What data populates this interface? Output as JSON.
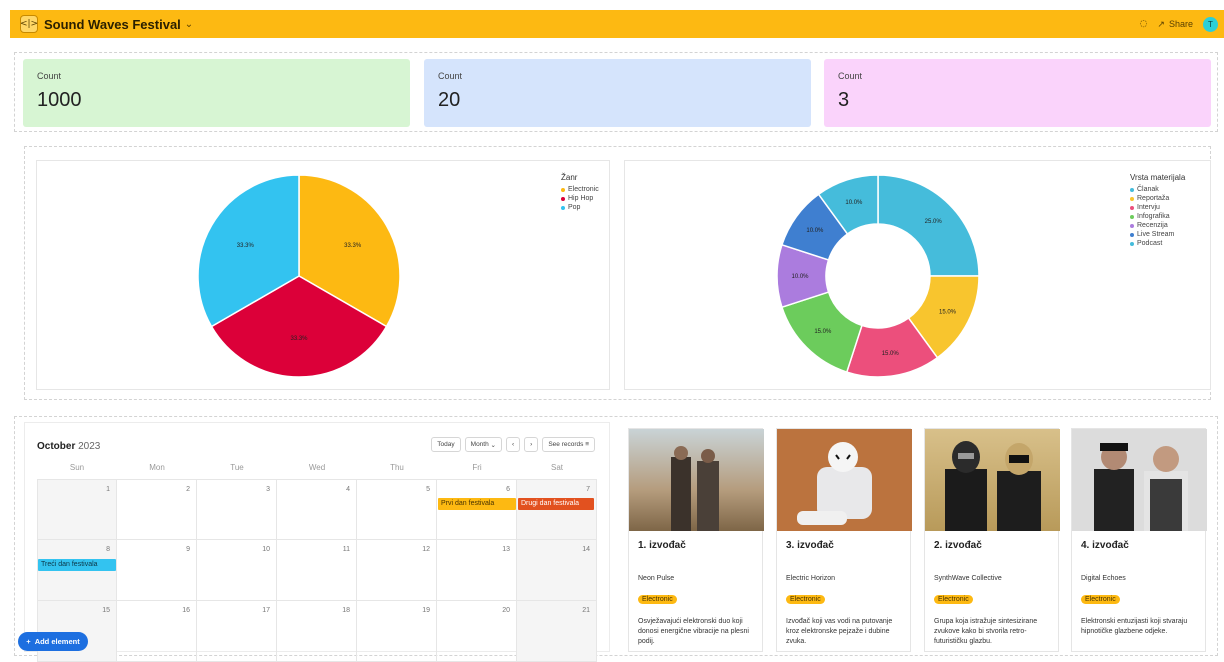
{
  "app": {
    "title": "Sound Waves Festival",
    "share_label": "Share",
    "avatar_initial": "T"
  },
  "stats": [
    {
      "label": "Count",
      "value": "1000",
      "color": "#d7f5d3"
    },
    {
      "label": "Count",
      "value": "20",
      "color": "#d5e4fc"
    },
    {
      "label": "Count",
      "value": "3",
      "color": "#fad3fb"
    }
  ],
  "chart_data": [
    {
      "type": "pie",
      "title": "Žanr",
      "categories": [
        "Electronic",
        "Hip Hop",
        "Pop"
      ],
      "values": [
        33.3,
        33.3,
        33.3
      ],
      "data_labels": [
        "33.3%",
        "33.3%",
        "33.3%"
      ],
      "colors": [
        "#fdb912",
        "#dc0039",
        "#33c3f0"
      ],
      "legend_position": "top-right"
    },
    {
      "type": "pie",
      "donut": true,
      "title": "Vrsta materijala",
      "categories": [
        "Članak",
        "Reportaža",
        "Intervju",
        "Infografika",
        "Recenzija",
        "Live Stream",
        "Podcast"
      ],
      "values": [
        25.0,
        15.0,
        15.0,
        15.0,
        10.0,
        10.0,
        10.0
      ],
      "data_labels": [
        "25.0%",
        "15.0%",
        "15.0%",
        "15.0%",
        "10.0%",
        "10.0%",
        "10.0%"
      ],
      "colors": [
        "#45bcdb",
        "#f8c52e",
        "#ec4f7c",
        "#6ccc5c",
        "#ab7cde",
        "#3f7fd0",
        "#45bcdb"
      ],
      "legend_position": "top-right"
    }
  ],
  "calendar": {
    "month": "October",
    "year": "2023",
    "buttons": {
      "today": "Today",
      "view": "Month",
      "prev": "‹",
      "next": "›",
      "see_records": "See records"
    },
    "weekdays": [
      "Sun",
      "Mon",
      "Tue",
      "Wed",
      "Thu",
      "Fri",
      "Sat"
    ],
    "days": [
      "1",
      "2",
      "3",
      "4",
      "5",
      "6",
      "7",
      "8",
      "9",
      "10",
      "11",
      "12",
      "13",
      "14",
      "15",
      "16",
      "17",
      "18",
      "19",
      "20",
      "21"
    ],
    "events": [
      {
        "label": "Prvi dan festivala",
        "color": "#fdb912",
        "text_color": "#4a3300"
      },
      {
        "label": "Drugi dan festivala",
        "color": "#e2511f",
        "text_color": "#ffffff"
      },
      {
        "label": "Treći dan festivala",
        "color": "#33c3f0",
        "text_color": "#0c3647"
      }
    ]
  },
  "artists": [
    {
      "title": "1. izvođač",
      "name": "Neon Pulse",
      "genre": "Electronic",
      "desc": "Osvježavajući elektronski duo koji donosi energične vibracije na plesni podij."
    },
    {
      "title": "3. izvođač",
      "name": "Electric Horizon",
      "genre": "Electronic",
      "desc": "Izvođač koji vas vodi na putovanje kroz elektronske pejzaže i dubine zvuka."
    },
    {
      "title": "2. izvođač",
      "name": "SynthWave Collective",
      "genre": "Electronic",
      "desc": "Grupa koja istražuje sintesizirane zvukove kako bi stvorila retro-futurističku glazbu."
    },
    {
      "title": "4. izvođač",
      "name": "Digital Echoes",
      "genre": "Electronic",
      "desc": "Elektronski entuzijasti koji stvaraju hipnotičke glazbene odjeke."
    }
  ],
  "add_element_label": "Add element"
}
